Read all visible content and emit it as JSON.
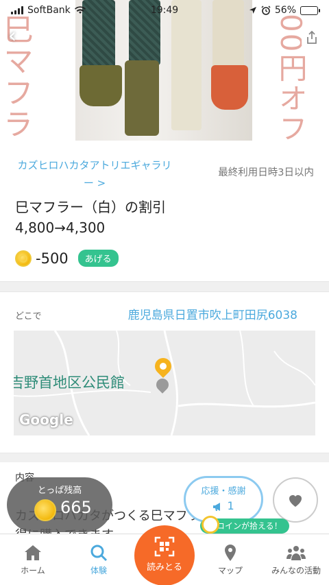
{
  "status_bar": {
    "carrier": "SoftBank",
    "time": "19:49",
    "battery_percent": "56%",
    "battery_level": 0.56
  },
  "hero": {
    "left_overlay_text": "巳マフラー・白",
    "right_overlay_text": "00円オフ"
  },
  "offer": {
    "shop_name": "カズヒロハカタアトリエギャラリー >",
    "last_use": "最終利用日時3日以内",
    "title": "巳マフラー（白）の割引",
    "price": "4,800→4,300",
    "coin_cost": "-500",
    "give_label": "あげる"
  },
  "location": {
    "label": "どこで",
    "address": "鹿児島県日置市吹上町田尻6038",
    "map_place_label": "吉野首地区公民館",
    "map_attribution": "Google"
  },
  "content": {
    "label": "内容",
    "line1": "カズヒロハカタがつくる巳マフラー（白）",
    "line2": "得に購入できます。"
  },
  "balance": {
    "label": "とっぱ残高",
    "value": "665"
  },
  "cheer": {
    "label": "応援・感謝",
    "count": "1",
    "coin_tag": "コインが拾える！"
  },
  "nav": {
    "items": [
      {
        "label": "ホーム",
        "icon": "home-icon"
      },
      {
        "label": "体験",
        "icon": "search-icon"
      },
      {
        "label": "読みとる",
        "icon": "qr-scan-icon"
      },
      {
        "label": "マップ",
        "icon": "map-pin-icon"
      },
      {
        "label": "みんなの活動",
        "icon": "people-icon"
      }
    ]
  },
  "colors": {
    "accent_blue": "#4ba9dd",
    "badge_green": "#34c38f",
    "scan_orange": "#f66a28",
    "coin_gold": "#f3b90e"
  }
}
